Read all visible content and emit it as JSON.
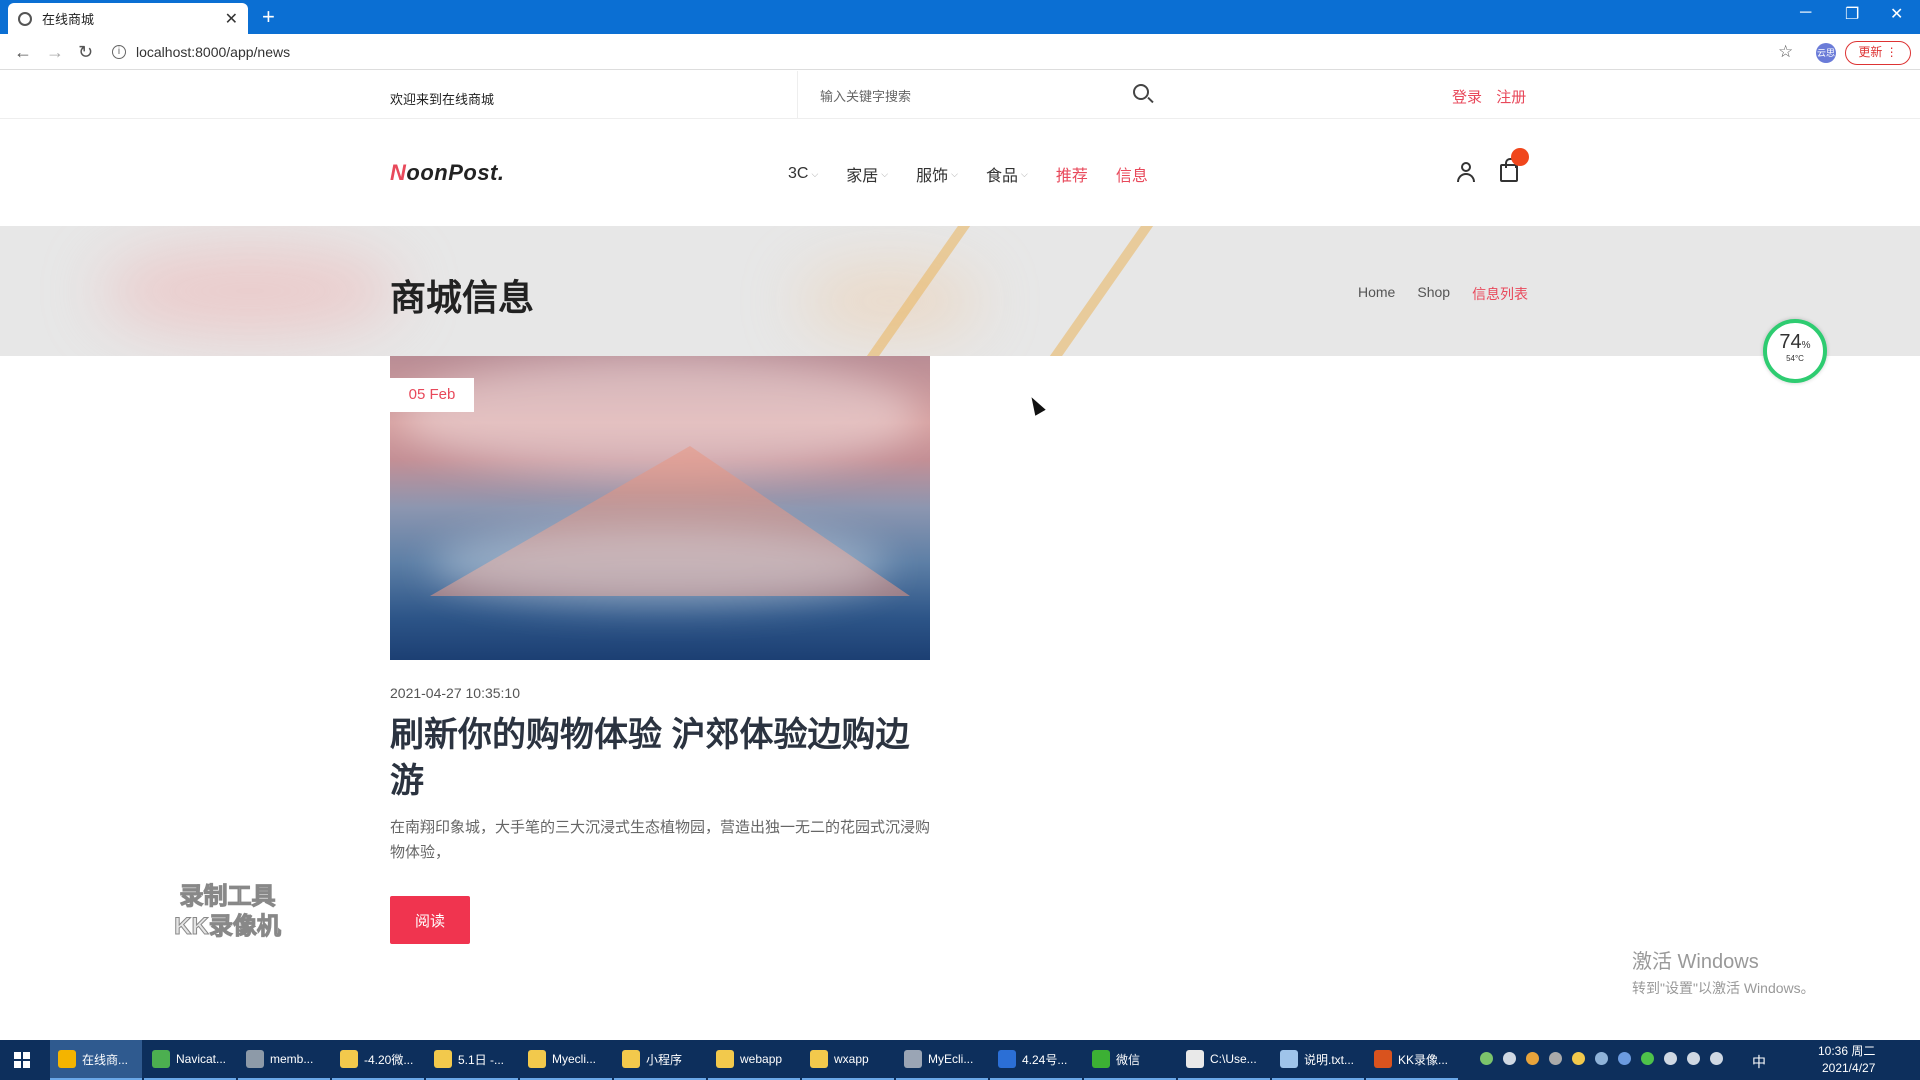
{
  "browser": {
    "tab_title": "在线商城",
    "url": "localhost:8000/app/news",
    "new_tab": "+",
    "update_label": "更新",
    "profile_label": "云思"
  },
  "topbar": {
    "welcome": "欢迎来到在线商城",
    "search_placeholder": "输入关键字搜索",
    "login": "登录",
    "register": "注册"
  },
  "header": {
    "logo_first": "N",
    "logo_rest": "oonPost.",
    "nav": [
      {
        "label": "3C"
      },
      {
        "label": "家居"
      },
      {
        "label": "服饰"
      },
      {
        "label": "食品"
      },
      {
        "label": "推荐"
      },
      {
        "label": "信息"
      }
    ]
  },
  "banner": {
    "title": "商城信息",
    "breadcrumbs": [
      "Home",
      "Shop",
      "信息列表"
    ]
  },
  "widget": {
    "percent": "74",
    "percent_unit": "%",
    "temp": "54°C"
  },
  "news": {
    "date": "05 Feb",
    "timestamp": "2021-04-27 10:35:10",
    "title": "刷新你的购物体验 沪郊体验边购边游",
    "summary": "在南翔印象城，大手笔的三大沉浸式生态植物园，营造出独一无二的花园式沉浸购物体验，",
    "read_button": "阅读"
  },
  "watermarks": {
    "recorder_line1": "录制工具",
    "recorder_line2": "KK录像机",
    "windows_line1": "激活 Windows",
    "windows_line2": "转到\"设置\"以激活 Windows。"
  },
  "taskbar": {
    "tasks": [
      {
        "label": "在线商...",
        "color": "#f4b400"
      },
      {
        "label": "Navicat...",
        "color": "#4caf50"
      },
      {
        "label": "memb...",
        "color": "#8d9aa8"
      },
      {
        "label": "-4.20微...",
        "color": "#f2c94c"
      },
      {
        "label": "5.1日 -...",
        "color": "#f2c94c"
      },
      {
        "label": "Myecli...",
        "color": "#f2c94c"
      },
      {
        "label": "小程序",
        "color": "#f2c94c"
      },
      {
        "label": "webapp",
        "color": "#f2c94c"
      },
      {
        "label": "wxapp",
        "color": "#f2c94c"
      },
      {
        "label": "MyEcli...",
        "color": "#9aa5b5"
      },
      {
        "label": "4.24号...",
        "color": "#2b6fd6"
      },
      {
        "label": "微信",
        "color": "#3cb034"
      },
      {
        "label": "C:\\Use...",
        "color": "#e9e9e9"
      },
      {
        "label": "说明.txt...",
        "color": "#9fc4ea"
      },
      {
        "label": "KK录像...",
        "color": "#d9531e"
      }
    ],
    "ime": "中",
    "time": "10:36 周二",
    "date": "2021/4/27"
  }
}
